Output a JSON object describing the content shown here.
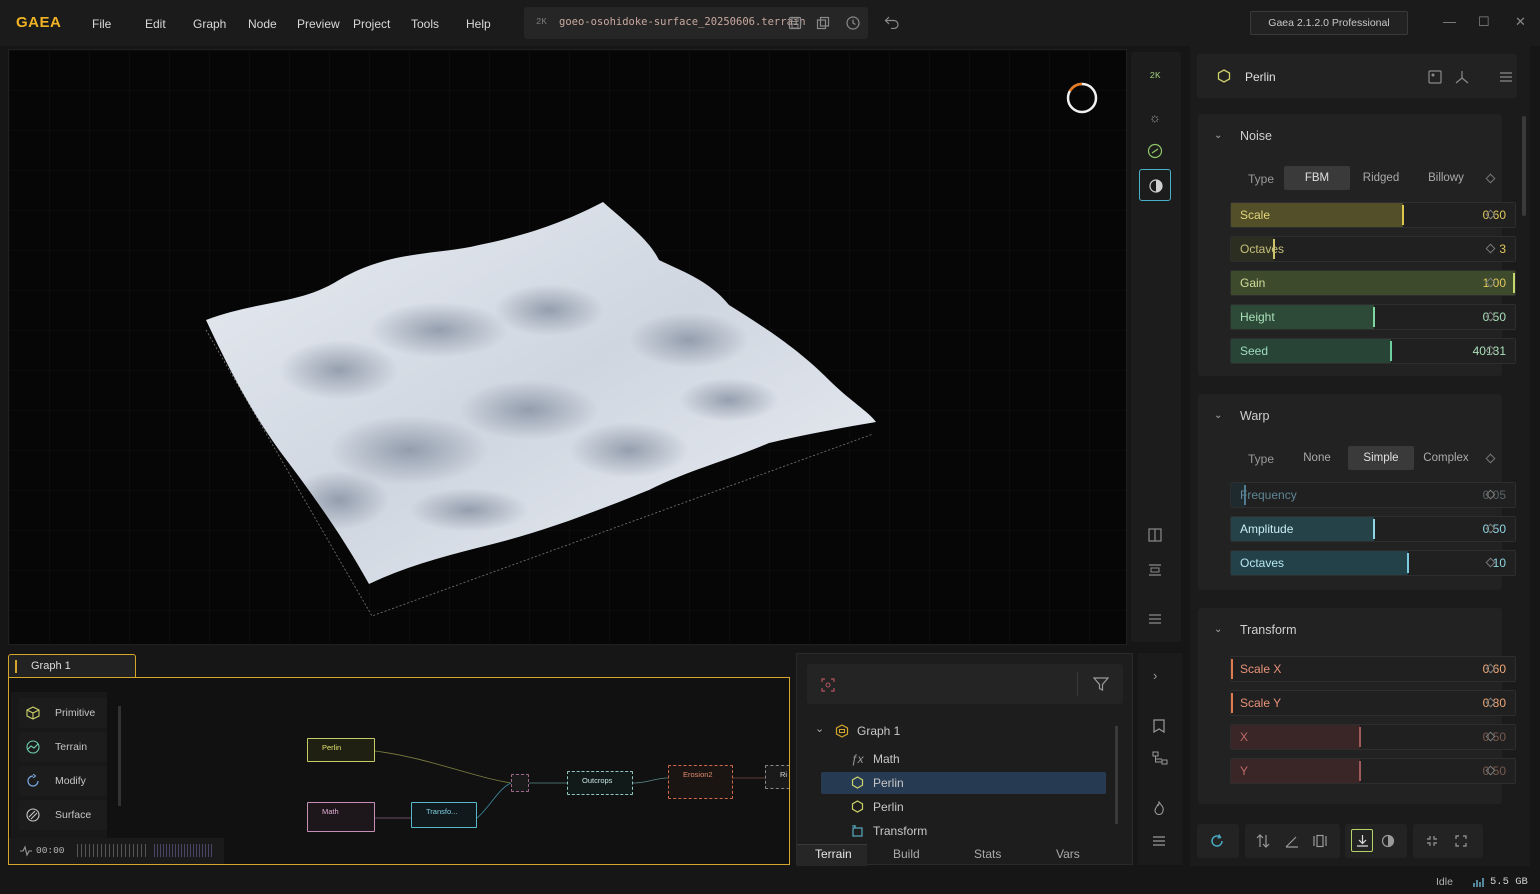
{
  "app": {
    "logo": "GAEA",
    "menu": [
      "File",
      "Edit",
      "Graph",
      "Node",
      "Preview",
      "Project",
      "Tools",
      "Help"
    ],
    "resolution_badge": "2K",
    "file_name": "goeo-osohidoke-surface_20250606.terrain",
    "edition": "Gaea 2.1.2.0 Professional",
    "accent_color": "#f0b323"
  },
  "viewport": {
    "toolbar_badge": "2K",
    "icons": [
      "resolution-icon",
      "sun-icon",
      "shading-icon",
      "view-mode-icon",
      "compare-icon",
      "bounds-icon",
      "menu-icon"
    ]
  },
  "properties": {
    "node_name": "Perlin",
    "noise": {
      "title": "Noise",
      "type_label": "Type",
      "types": [
        "FBM",
        "Ridged",
        "Billowy"
      ],
      "selected_type": "FBM",
      "params": [
        {
          "label": "Scale",
          "value": "0.60",
          "fraction": 0.6,
          "fill": "#535029",
          "mark": "#d8c74a",
          "label_color": "#e2d57a"
        },
        {
          "label": "Octaves",
          "value": "3",
          "fraction": 0.15,
          "fill": "#2c2e22",
          "mark": "#cfc36a",
          "label_color": "#c5c07a"
        },
        {
          "label": "Gain",
          "value": "1.00",
          "fraction": 1.0,
          "fill": "#3e4a2c",
          "mark": "#c7d86a",
          "label_color": "#d2dc9a"
        },
        {
          "label": "Height",
          "value": "0.50",
          "fraction": 0.5,
          "fill": "#2d4a38",
          "mark": "#7fd6a0",
          "label_color": "#a8e0b8"
        },
        {
          "label": "Seed",
          "value": "40131",
          "fraction": 0.56,
          "fill": "#274437",
          "mark": "#6ecf9e",
          "label_color": "#9fdcc0"
        }
      ]
    },
    "warp": {
      "title": "Warp",
      "type_label": "Type",
      "types": [
        "None",
        "Simple",
        "Complex"
      ],
      "selected_type": "Simple",
      "params": [
        {
          "label": "Frequency",
          "value": "0.05",
          "fraction": 0.05,
          "fill": "#1f2a2e",
          "mark": "#4f7d8f",
          "label_color": "#5f8596",
          "dim": true
        },
        {
          "label": "Amplitude",
          "value": "0.50",
          "fraction": 0.5,
          "fill": "#254249",
          "mark": "#8fd6e4",
          "label_color": "#c9eef4"
        },
        {
          "label": "Octaves",
          "value": "10",
          "fraction": 0.62,
          "fill": "#234149",
          "mark": "#7ccbe0",
          "label_color": "#b6e7f2"
        }
      ]
    },
    "transform": {
      "title": "Transform",
      "params": [
        {
          "label": "Scale X",
          "value": "0.60",
          "fraction": 0.0,
          "fill": "#2a1e1a",
          "mark": "#e07a4f",
          "label_color": "#e8927a"
        },
        {
          "label": "Scale Y",
          "value": "0.80",
          "fraction": 0.0,
          "fill": "#2a1e1a",
          "mark": "#e07a4f",
          "label_color": "#e8927a"
        },
        {
          "label": "X",
          "value": "0.50",
          "fraction": 0.45,
          "fill": "#3a2626",
          "mark": "#9e5a5a",
          "label_color": "#c06a6a",
          "dim": true
        },
        {
          "label": "Y",
          "value": "0.50",
          "fraction": 0.45,
          "fill": "#3a2626",
          "mark": "#9e5a5a",
          "label_color": "#c06a6a",
          "dim": true
        }
      ]
    }
  },
  "graph": {
    "tab_label": "Graph 1",
    "palette": [
      {
        "label": "Primitive",
        "icon": "cube-icon",
        "color": "#cdd26a"
      },
      {
        "label": "Terrain",
        "icon": "terrain-icon",
        "color": "#6ecfb0"
      },
      {
        "label": "Modify",
        "icon": "modify-icon",
        "color": "#7aa8e0"
      },
      {
        "label": "Surface",
        "icon": "surface-icon",
        "color": "#c8c8c8"
      }
    ],
    "nodes": [
      {
        "label": "Perlin",
        "color": "#c7cd66"
      },
      {
        "label": "Math",
        "color": "#c58fb8"
      },
      {
        "label": "Transfo...",
        "color": "#5bb7cc"
      },
      {
        "label": "Outcrops",
        "color": "#8fc7c0"
      },
      {
        "label": "Erosion2",
        "color": "#d0684c"
      },
      {
        "label": "Ri",
        "color": "#c8c8c8"
      }
    ],
    "timeline": "00:00"
  },
  "tree": {
    "root": "Graph 1",
    "items": [
      {
        "label": "Math",
        "icon": "function-icon"
      },
      {
        "label": "Perlin",
        "icon": "hexagon-icon",
        "selected": true
      },
      {
        "label": "Perlin",
        "icon": "hexagon-icon"
      },
      {
        "label": "Transform",
        "icon": "transform-icon"
      }
    ],
    "tabs": [
      "Terrain",
      "Build",
      "Stats",
      "Vars"
    ],
    "active_tab": "Terrain"
  },
  "status": {
    "state": "Idle",
    "memory": "5.5 GB"
  }
}
